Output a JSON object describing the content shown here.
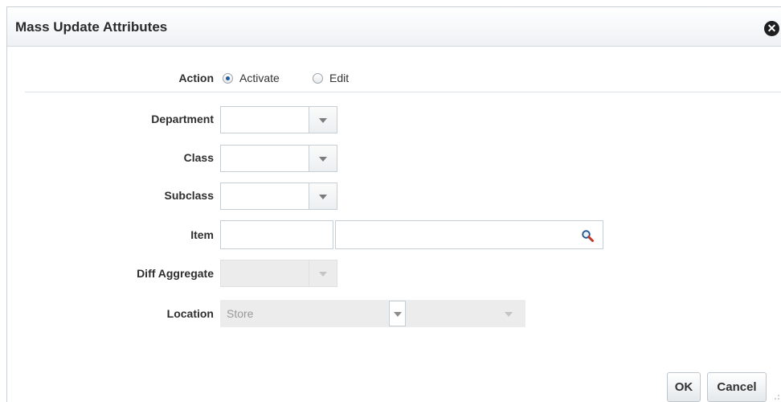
{
  "dialog": {
    "title": "Mass Update Attributes",
    "close_icon": "close-icon"
  },
  "action": {
    "label": "Action",
    "options": [
      {
        "label": "Activate",
        "selected": true
      },
      {
        "label": "Edit",
        "selected": false
      }
    ]
  },
  "fields": {
    "department": {
      "label": "Department",
      "value": ""
    },
    "class": {
      "label": "Class",
      "value": ""
    },
    "subclass": {
      "label": "Subclass",
      "value": ""
    },
    "item": {
      "label": "Item",
      "value": "",
      "description": ""
    },
    "diff_aggregate": {
      "label": "Diff Aggregate",
      "value": "",
      "disabled": true
    },
    "location": {
      "label": "Location",
      "type_value": "Store",
      "value": "",
      "disabled": true
    }
  },
  "buttons": {
    "ok": "OK",
    "cancel": "Cancel"
  },
  "colors": {
    "radio_selected": "#1d5aa6",
    "search_icon": "#c0392b"
  }
}
